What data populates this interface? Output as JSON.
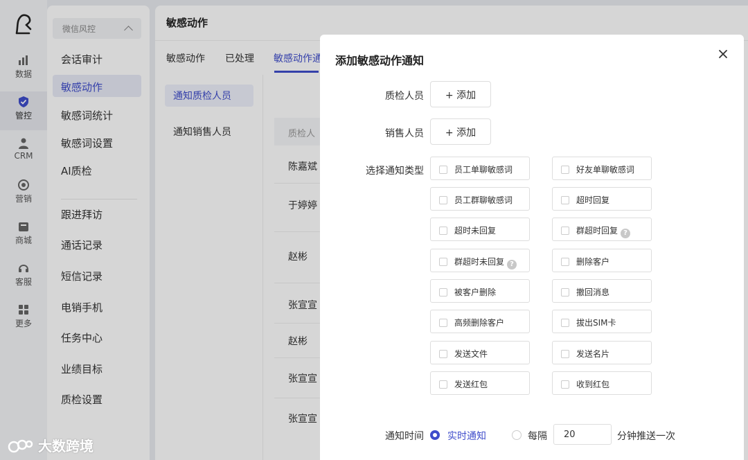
{
  "rail": {
    "items": [
      {
        "label": "数据",
        "icon": "bar-chart-icon"
      },
      {
        "label": "管控",
        "icon": "shield-icon"
      },
      {
        "label": "CRM",
        "icon": "person-icon"
      },
      {
        "label": "营销",
        "icon": "target-icon"
      },
      {
        "label": "商城",
        "icon": "store-icon"
      },
      {
        "label": "客服",
        "icon": "headset-icon"
      },
      {
        "label": "更多",
        "icon": "grid-icon"
      }
    ]
  },
  "submenu": {
    "group_title": "微信风控",
    "items": [
      {
        "label": "会话审计"
      },
      {
        "label": "敏感动作"
      },
      {
        "label": "敏感词统计"
      },
      {
        "label": "敏感词设置"
      },
      {
        "label": "AI质检"
      },
      {
        "label": "跟进拜访"
      },
      {
        "label": "通话记录"
      },
      {
        "label": "短信记录"
      },
      {
        "label": "电销手机"
      },
      {
        "label": "任务中心"
      },
      {
        "label": "业绩目标"
      },
      {
        "label": "质检设置"
      }
    ]
  },
  "main": {
    "title": "敏感动作",
    "tabs": [
      {
        "label": "敏感动作"
      },
      {
        "label": "已处理"
      },
      {
        "label": "敏感动作通"
      }
    ],
    "left_items": [
      {
        "label": "通知质检人员"
      },
      {
        "label": "通知销售人员"
      }
    ],
    "table_header": "质检人",
    "rows": [
      "陈嘉斌",
      "于婷婷",
      "赵彬",
      "张宣宣",
      "赵彬",
      "张宣宣",
      "张宣宣"
    ]
  },
  "modal": {
    "title": "添加敏感动作通知",
    "inspector_label": "质检人员",
    "sales_label": "销售人员",
    "add_label": "+ 添加",
    "type_label": "选择通知类型",
    "types": [
      "员工单聊敏感词",
      "好友单聊敏感词",
      "员工群聊敏感词",
      "超时回复",
      "超时未回复",
      "群超时回复",
      "群超时未回复",
      "删除客户",
      "被客户删除",
      "撤回消息",
      "高频删除客户",
      "拔出SIM卡",
      "发送文件",
      "发送名片",
      "发送红包",
      "收到红包"
    ],
    "help_mark": "?",
    "time_label": "通知时间",
    "realtime_label": "实时通知",
    "interval_prefix": "每隔",
    "interval_value": "20",
    "interval_suffix": "分钟推送一次"
  },
  "brand": {
    "text": "大数跨境"
  },
  "colors": {
    "accent": "#3f4dcb"
  }
}
